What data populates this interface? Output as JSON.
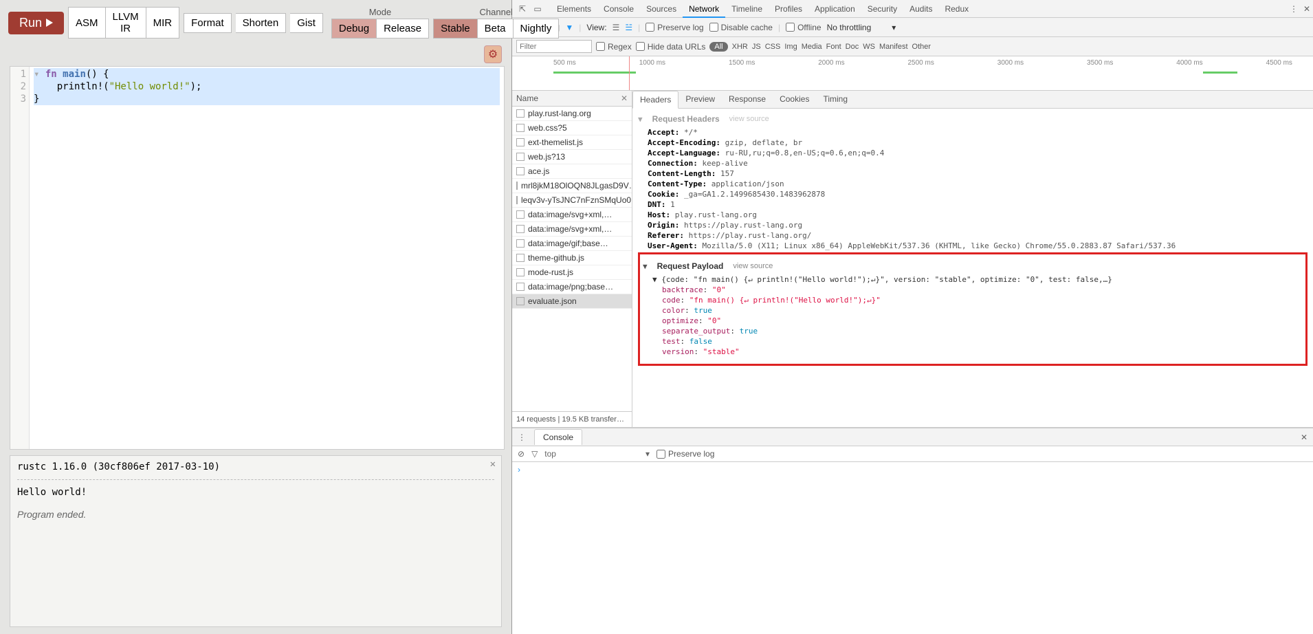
{
  "toolbar": {
    "run": "Run",
    "asm": "ASM",
    "llvm": "LLVM IR",
    "mir": "MIR",
    "format": "Format",
    "shorten": "Shorten",
    "gist": "Gist",
    "mode_label": "Mode",
    "channel_label": "Channel",
    "debug": "Debug",
    "release": "Release",
    "stable": "Stable",
    "beta": "Beta",
    "nightly": "Nightly"
  },
  "editor": {
    "lines": [
      "1",
      "2",
      "3"
    ],
    "code_l1a": "fn ",
    "code_l1b": "main",
    "code_l1c": "() {",
    "code_l2a": "    println!(",
    "code_l2b": "\"Hello world!\"",
    "code_l2c": ");",
    "code_l3": "}"
  },
  "output": {
    "compiler": "rustc 1.16.0 (30cf806ef 2017-03-10)",
    "stdout": "Hello world!",
    "ended": "Program ended."
  },
  "devtools": {
    "tabs": [
      "Elements",
      "Console",
      "Sources",
      "Network",
      "Timeline",
      "Profiles",
      "Application",
      "Security",
      "Audits",
      "Redux"
    ],
    "active_tab": "Network",
    "row2": {
      "view": "View:",
      "preserve": "Preserve log",
      "disable": "Disable cache",
      "offline": "Offline",
      "throttle": "No throttling"
    },
    "row3": {
      "filter_ph": "Filter",
      "regex": "Regex",
      "hide": "Hide data URLs",
      "types": [
        "All",
        "XHR",
        "JS",
        "CSS",
        "Img",
        "Media",
        "Font",
        "Doc",
        "WS",
        "Manifest",
        "Other"
      ]
    },
    "timeline_ticks": [
      "500 ms",
      "1000 ms",
      "1500 ms",
      "2000 ms",
      "2500 ms",
      "3000 ms",
      "3500 ms",
      "4000 ms",
      "4500 ms"
    ],
    "requests": {
      "header": "Name",
      "items": [
        "play.rust-lang.org",
        "web.css?5",
        "ext-themelist.js",
        "web.js?13",
        "ace.js",
        "mrl8jkM18OlOQN8JLgasD9V…",
        "leqv3v-yTsJNC7nFznSMqUo0…",
        "data:image/svg+xml,…",
        "data:image/svg+xml,…",
        "data:image/gif;base…",
        "theme-github.js",
        "mode-rust.js",
        "data:image/png;base…",
        "evaluate.json"
      ],
      "selected": 13,
      "footer": "14 requests   |   19.5 KB transfer…"
    },
    "detail": {
      "tabs": [
        "Headers",
        "Preview",
        "Response",
        "Cookies",
        "Timing"
      ],
      "req_headers_title": "Request Headers",
      "view_source": "view source",
      "headers": {
        "Accept": "*/*",
        "Accept-Encoding": "gzip, deflate, br",
        "Accept-Language": "ru-RU,ru;q=0.8,en-US;q=0.6,en;q=0.4",
        "Connection": "keep-alive",
        "Content-Length": "157",
        "Content-Type": "application/json",
        "Cookie": "_ga=GA1.2.1499685430.1483962878",
        "DNT": "1",
        "Host": "play.rust-lang.org",
        "Origin": "https://play.rust-lang.org",
        "Referer": "https://play.rust-lang.org/",
        "User-Agent": "Mozilla/5.0 (X11; Linux x86_64) AppleWebKit/537.36 (KHTML, like Gecko) Chrome/55.0.2883.87 Safari/537.36"
      },
      "payload_title": "Request Payload",
      "payload_summary": "{code: \"fn main() {↵ println!(\"Hello world!\");↵}\", version: \"stable\", optimize: \"0\", test: false,…}",
      "payload": {
        "backtrace": "\"0\"",
        "code": "\"fn main() {↵    println!(\"Hello world!\");↵}\"",
        "color": "true",
        "optimize": "\"0\"",
        "separate_output": "true",
        "test": "false",
        "version": "\"stable\""
      }
    },
    "console": {
      "tab": "Console",
      "top": "top",
      "preserve": "Preserve log"
    }
  }
}
